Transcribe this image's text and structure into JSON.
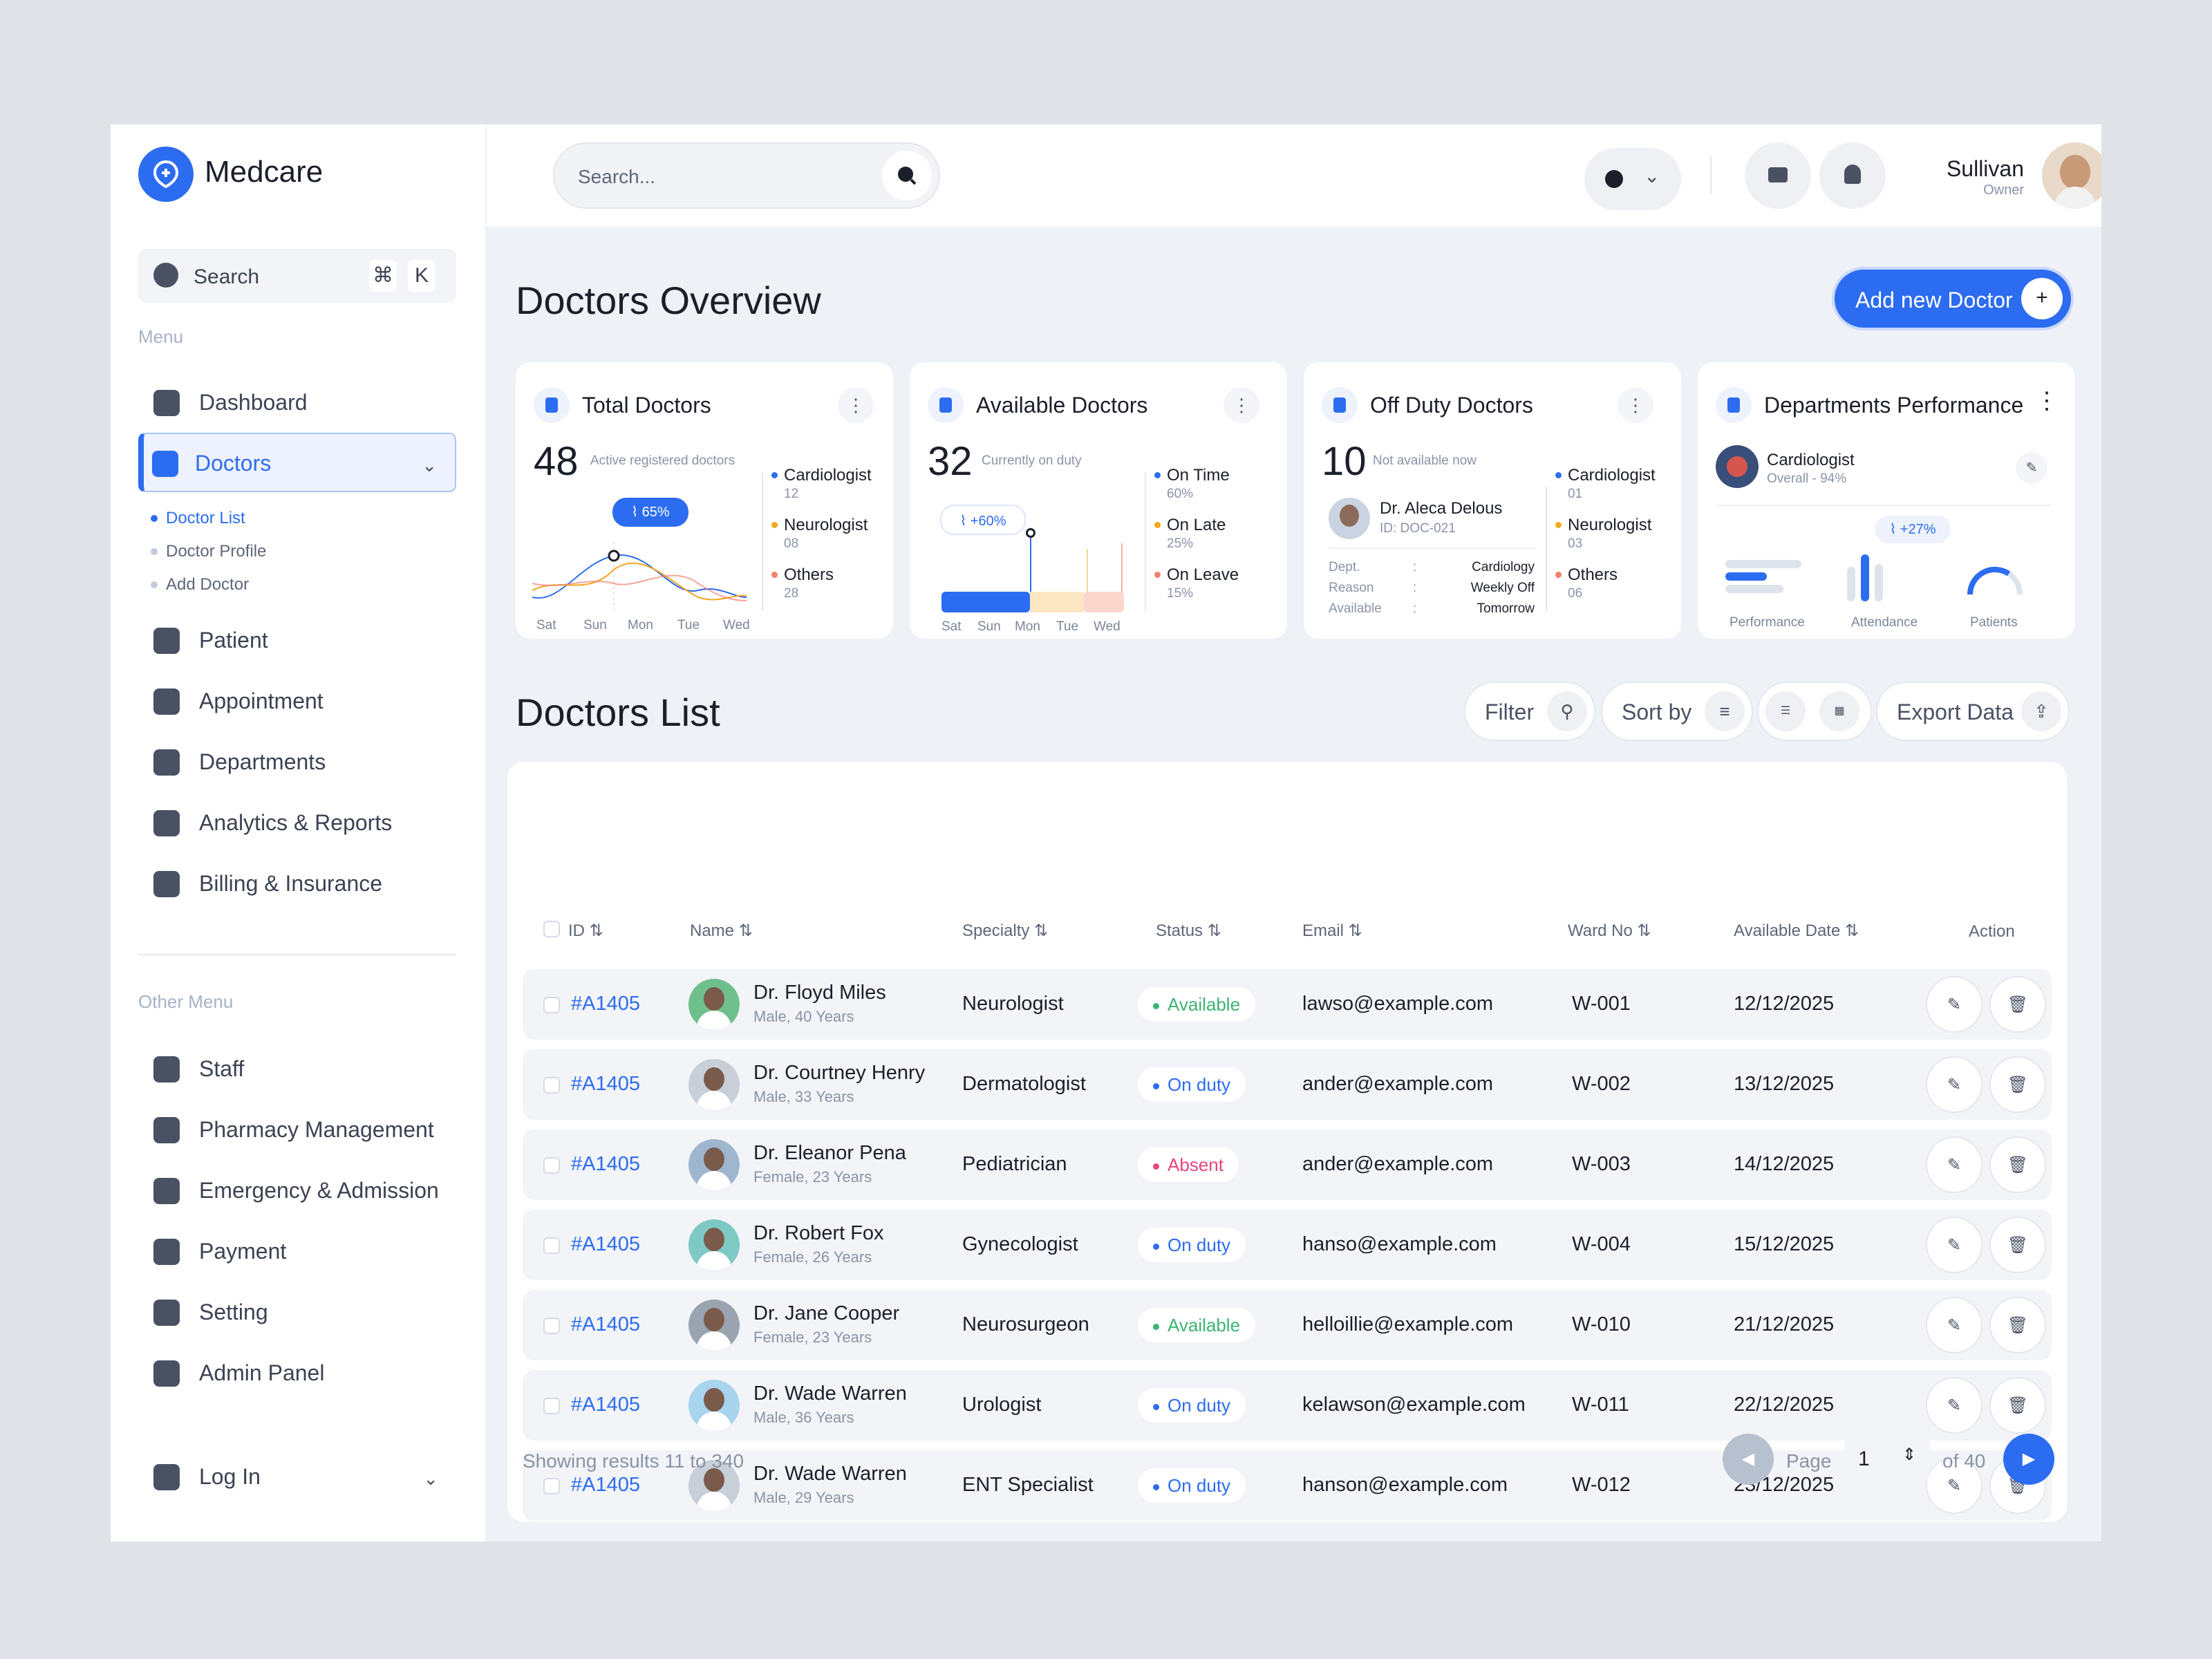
{
  "app": {
    "brand": "Medcare"
  },
  "sidebar": {
    "search_label": "Search",
    "search_keys": [
      "⌘",
      "K"
    ],
    "menu_label": "Menu",
    "items": [
      {
        "label": "Dashboard",
        "icon": "grid-icon"
      },
      {
        "label": "Doctors",
        "icon": "user-plus-icon",
        "active": true
      },
      {
        "label": "Patient",
        "icon": "patient-icon"
      },
      {
        "label": "Appointment",
        "icon": "calendar-icon"
      },
      {
        "label": "Departments",
        "icon": "hospital-icon"
      },
      {
        "label": "Analytics & Reports",
        "icon": "analytics-icon"
      },
      {
        "label": "Billing & Insurance",
        "icon": "shield-icon"
      }
    ],
    "doctor_sub": [
      "Doctor List",
      "Doctor Profile",
      "Add Doctor"
    ],
    "other_label": "Other Menu",
    "other_items": [
      {
        "label": "Staff",
        "icon": "staff-icon"
      },
      {
        "label": "Pharmacy Management",
        "icon": "briefcase-icon"
      },
      {
        "label": "Emergency & Admission",
        "icon": "hourglass-icon"
      },
      {
        "label": "Payment",
        "icon": "wallet-icon"
      },
      {
        "label": "Setting",
        "icon": "gear-icon"
      },
      {
        "label": "Admin Panel",
        "icon": "admin-icon"
      }
    ],
    "login_label": "Log In"
  },
  "topbar": {
    "search_placeholder": "Search...",
    "user_name": "Sullivan",
    "user_role": "Owner"
  },
  "overview": {
    "title": "Doctors Overview",
    "add_button": "Add new Doctor",
    "total": {
      "title": "Total Doctors",
      "value": "48",
      "subtitle": "Active registered doctors",
      "badge": "65%",
      "legend": [
        {
          "label": "Cardiologist",
          "value": "12",
          "color": "#2c6cf0"
        },
        {
          "label": "Neurologist",
          "value": "08",
          "color": "#f5a623"
        },
        {
          "label": "Others",
          "value": "28",
          "color": "#f07f6b"
        }
      ],
      "days": [
        "Sat",
        "Sun",
        "Mon",
        "Tue",
        "Wed"
      ]
    },
    "available": {
      "title": "Available Doctors",
      "value": "32",
      "subtitle": "Currently on duty",
      "badge": "+60%",
      "legend": [
        {
          "label": "On Time",
          "value": "60%",
          "color": "#2c6cf0"
        },
        {
          "label": "On Late",
          "value": "25%",
          "color": "#f5a623"
        },
        {
          "label": "On Leave",
          "value": "15%",
          "color": "#f07f6b"
        }
      ],
      "days": [
        "Sat",
        "Sun",
        "Mon",
        "Tue",
        "Wed"
      ]
    },
    "offduty": {
      "title": "Off Duty Doctors",
      "value": "10",
      "subtitle": "Not available now",
      "doctor_name": "Dr. Aleca Delous",
      "doctor_id": "ID: DOC-021",
      "details": [
        {
          "k": "Dept.",
          "v": "Cardiology"
        },
        {
          "k": "Reason",
          "v": "Weekly Off"
        },
        {
          "k": "Available",
          "v": "Tomorrow"
        }
      ],
      "legend": [
        {
          "label": "Cardiologist",
          "value": "01",
          "color": "#2c6cf0"
        },
        {
          "label": "Neurologist",
          "value": "03",
          "color": "#f5a623"
        },
        {
          "label": "Others",
          "value": "06",
          "color": "#f07f6b"
        }
      ]
    },
    "departments": {
      "title": "Departments Performance",
      "dept_name": "Cardiologist",
      "dept_overall": "Overall - 94%",
      "badge": "+27%",
      "metrics": [
        "Performance",
        "Attendance",
        "Patients"
      ]
    }
  },
  "list": {
    "title": "Doctors List",
    "filter": "Filter",
    "sort": "Sort by",
    "export": "Export Data",
    "columns": [
      "ID",
      "Name",
      "Specialty",
      "Status",
      "Email",
      "Ward No",
      "Available Date",
      "Action"
    ],
    "rows": [
      {
        "id": "#A1405",
        "name": "Dr. Floyd Miles",
        "meta": "Male, 40 Years",
        "specialty": "Neurologist",
        "status": "Available",
        "email": "lawso@example.com",
        "ward": "W-001",
        "date": "12/12/2025"
      },
      {
        "id": "#A1405",
        "name": "Dr. Courtney Henry",
        "meta": "Male, 33 Years",
        "specialty": "Dermatologist",
        "status": "On duty",
        "email": "ander@example.com",
        "ward": "W-002",
        "date": "13/12/2025"
      },
      {
        "id": "#A1405",
        "name": "Dr. Eleanor Pena",
        "meta": "Female, 23 Years",
        "specialty": "Pediatrician",
        "status": "Absent",
        "email": "ander@example.com",
        "ward": "W-003",
        "date": "14/12/2025"
      },
      {
        "id": "#A1405",
        "name": "Dr. Robert Fox",
        "meta": "Female, 26 Years",
        "specialty": "Gynecologist",
        "status": "On duty",
        "email": "hanso@example.com",
        "ward": "W-004",
        "date": "15/12/2025"
      },
      {
        "id": "#A1405",
        "name": "Dr. Jane Cooper",
        "meta": "Female, 23 Years",
        "specialty": "Neurosurgeon",
        "status": "Available",
        "email": "helloillie@example.com",
        "ward": "W-010",
        "date": "21/12/2025"
      },
      {
        "id": "#A1405",
        "name": "Dr. Wade Warren",
        "meta": "Male, 36 Years",
        "specialty": "Urologist",
        "status": "On duty",
        "email": "kelawson@example.com",
        "ward": "W-011",
        "date": "22/12/2025"
      },
      {
        "id": "#A1405",
        "name": "Dr. Wade Warren",
        "meta": "Male, 29 Years",
        "specialty": "ENT Specialist",
        "status": "On duty",
        "email": "hanson@example.com",
        "ward": "W-012",
        "date": "23/12/2025"
      }
    ],
    "status_colors": {
      "Available": "#3cb371",
      "On duty": "#2c6cf0",
      "Absent": "#e8457a"
    },
    "footer": "Showing results 11 to 340",
    "page_label": "Page",
    "page_value": "1",
    "page_of": "of 40"
  }
}
